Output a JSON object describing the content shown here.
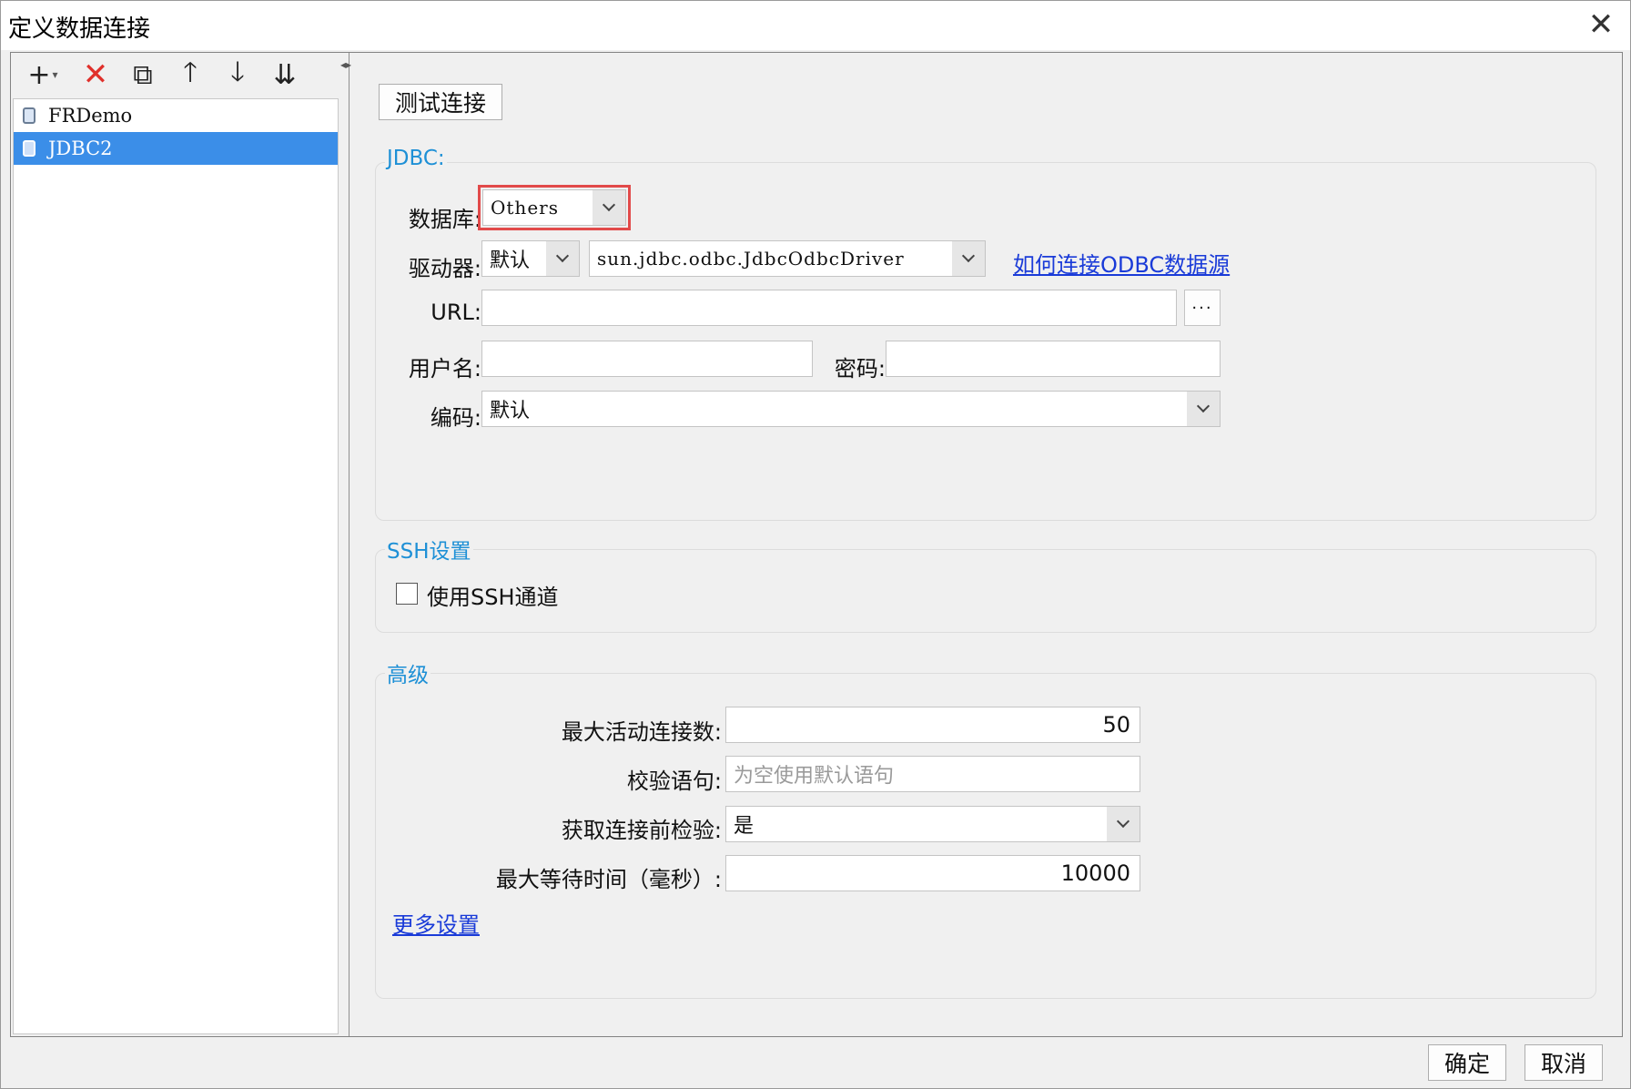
{
  "window": {
    "title": "定义数据连接",
    "close_glyph": "✕"
  },
  "toolbar": {
    "add_glyph": "+",
    "add_caret": "▾",
    "delete_glyph": "✕",
    "copy_glyph": "⧉",
    "up_glyph": "🡑",
    "down_glyph": "🡓",
    "sort_glyph": "⇊",
    "collapse_glyph": "◂▸"
  },
  "connections": {
    "items": [
      {
        "label": "FRDemo",
        "selected": false
      },
      {
        "label": "JDBC2",
        "selected": true
      }
    ]
  },
  "test_button": "测试连接",
  "jdbc": {
    "group_title": "JDBC:",
    "database_label": "数据库:",
    "database_value": "Others",
    "driver_label": "驱动器:",
    "driver_mode": "默认",
    "driver_class": "sun.jdbc.odbc.JdbcOdbcDriver",
    "odbc_help_link": "如何连接ODBC数据源",
    "url_label": "URL:",
    "url_value": "",
    "url_more": "···",
    "username_label": "用户名:",
    "username_value": "",
    "password_label": "密码:",
    "password_value": "",
    "encoding_label": "编码:",
    "encoding_value": "默认"
  },
  "ssh": {
    "group_title": "SSH设置",
    "use_ssh_label": "使用SSH通道",
    "use_ssh_checked": false
  },
  "advanced": {
    "group_title": "高级",
    "max_active_label": "最大活动连接数:",
    "max_active_value": "50",
    "validation_label": "校验语句:",
    "validation_placeholder": "为空使用默认语句",
    "test_before_label": "获取连接前检验:",
    "test_before_value": "是",
    "max_wait_label": "最大等待时间（毫秒）:",
    "max_wait_value": "10000",
    "more_settings_link": "更多设置"
  },
  "footer": {
    "ok_label": "确定",
    "cancel_label": "取消"
  },
  "colors": {
    "accent": "#3b8ee8",
    "group_title": "#1e90d6",
    "highlight": "#e24a4a",
    "link": "#1a3bd8",
    "delete": "#e0302b"
  }
}
